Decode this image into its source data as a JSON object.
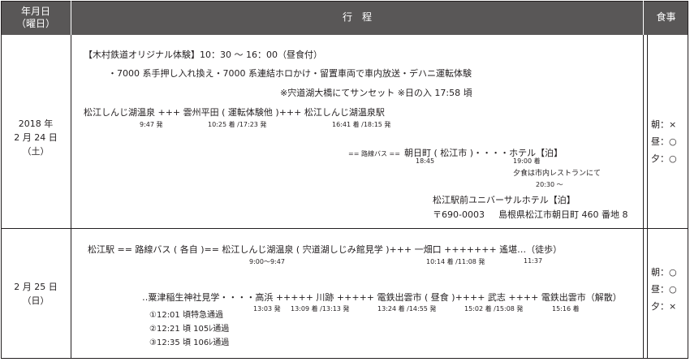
{
  "header": {
    "date_line1": "年月日",
    "date_line2": "（曜日）",
    "itinerary": "行　程",
    "meals": "食事"
  },
  "day1": {
    "date_line1": "2018 年",
    "date_line2": "2 月 24 日",
    "date_line3": "（土）",
    "exp_title": "【木村鉄道オリジナル体験】10：30 〜 16：00（昼食付）",
    "exp_detail": "・7000 系手押し入れ換え・7000 系連結ホロかけ・留置車両で車内放送・デハニ運転体験",
    "sunset": "※宍道湖大橋にてサンセット ※日の入 17:58 頃",
    "route1": "松江しんじ湖温泉 +++ 雲州平田 ( 運転体験他 )+++ 松江しんじ湖温泉駅",
    "t1": "9:47 発",
    "t2": "10:25 着 /17:23 発",
    "t3": "16:41 着 /18:15 発",
    "bus_prefix": "== 路線バス ==",
    "bus_route": "朝日町 ( 松江市 )・・・・ホテル【泊】",
    "t4": "18:45",
    "t5": "19:00 着",
    "dinner": "夕食は市内レストランにて",
    "t6": "20:30 〜",
    "hotel_name": "松江駅前ユニバーサルホテル【泊】",
    "hotel_zip": "〒690-0003",
    "hotel_addr": "島根県松江市朝日町 460 番地 8",
    "meal_breakfast": "朝：×",
    "meal_lunch": "昼：○",
    "meal_dinner": "夕：○"
  },
  "day2": {
    "date_line1": "2 月 25 日",
    "date_line2": "（日）",
    "route1": "松江駅 == 路線バス ( 各自 )== 松江しんじ湖温泉 ( 宍道湖しじみ館見学 )+++ 一畑口 +++++++ 遙堪…（徒歩）",
    "t1": "9:00〜9:47",
    "t2": "10:14 着 /11:08 発",
    "t3": "11:37",
    "route2": "‥粟津稲生神社見学・・・・高浜 +++++ 川跡 +++++ 電鉄出雲市 ( 昼食 )++++ 武志 ++++ 電鉄出雲市（解散）",
    "t4": "13:03 発",
    "t5": "13:09 着 /13:13 発",
    "t6": "13:24 着 /14:55 発",
    "t7": "15:02 着 /15:08 発",
    "t8": "15:16 着",
    "pass1": "①12:01 頃特急通過",
    "pass2": "②12:21 頃 105ﾚ通過",
    "pass3": "③12:35 頃 106ﾚ通過",
    "meal_breakfast": "朝：○",
    "meal_lunch": "昼：○",
    "meal_dinner": "夕：×"
  }
}
